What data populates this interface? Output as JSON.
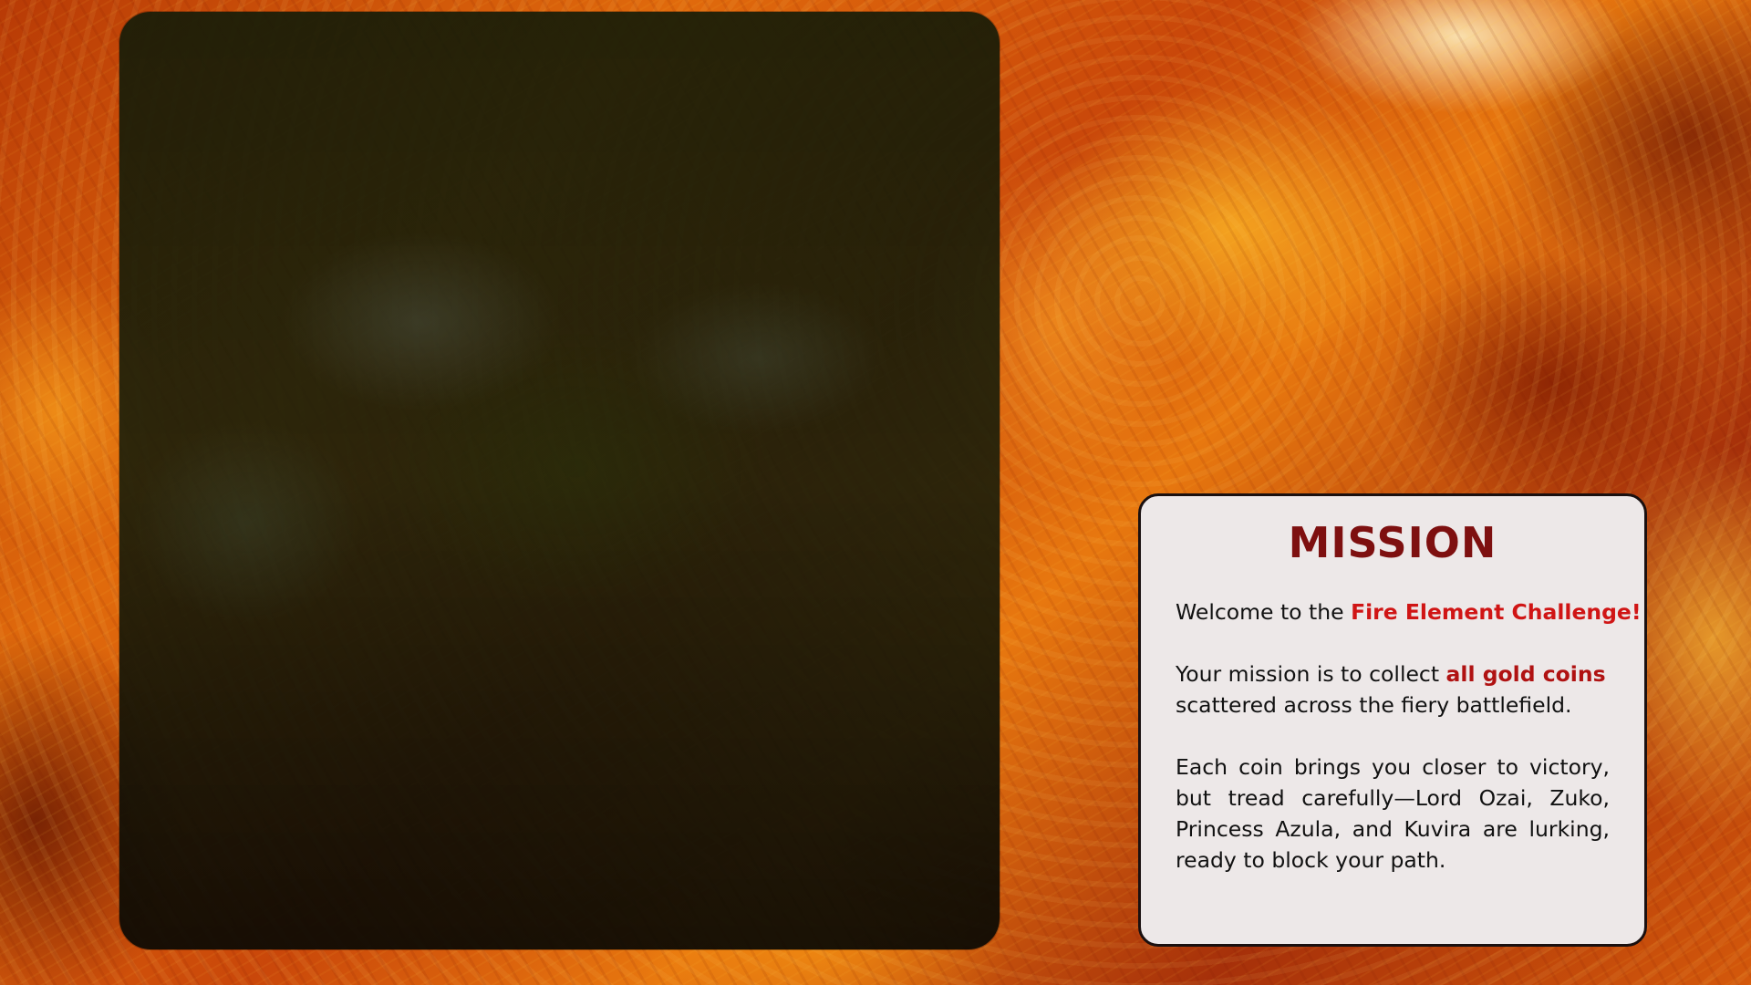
{
  "mission": {
    "title": "MISSION",
    "welcome_prefix": "Welcome to the ",
    "welcome_highlight": "Fire Element Challenge!",
    "goal_prefix": "Your mission is to collect ",
    "goal_highlight": "all gold coins",
    "goal_suffix": " scattered across the fiery battlefield.",
    "warning": "Each coin brings you closer to victory, but tread carefully—Lord Ozai, Zuko, Princess Azula, and Kuvira are lurking, ready to block your path."
  },
  "colors": {
    "title": "#7e1010",
    "highlight": "#d01515",
    "card_background": "#ede8e8",
    "card_border": "#1a1010"
  }
}
